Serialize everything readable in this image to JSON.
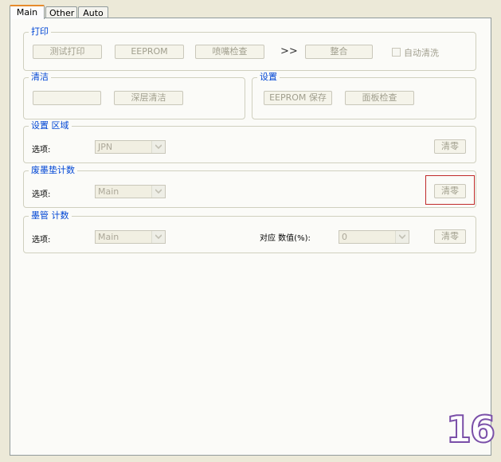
{
  "tabs": [
    {
      "label": "Main"
    },
    {
      "label": "Other"
    },
    {
      "label": "Auto"
    }
  ],
  "print_group": {
    "title": "打印",
    "btn_test_print": "测试打印",
    "btn_eeprom": "EEPROM",
    "btn_nozzle_check": "喷嘴检查",
    "arrow": ">>",
    "btn_align": "整合",
    "auto_clean_label": "自动清洗"
  },
  "clean_group": {
    "title": "清洁",
    "btn_blank": "",
    "btn_deep_clean": "深层清洁"
  },
  "settings_group": {
    "title": "设置",
    "btn_eeprom_save": "EEPROM 保存",
    "btn_panel_check": "面板检查"
  },
  "region_group": {
    "title": "设置 区域",
    "select_label": "选项:",
    "select_value": "JPN",
    "btn_reset": "清零"
  },
  "waste_group": {
    "title": "废墨垫计数",
    "select_label": "选项:",
    "select_value": "Main",
    "btn_reset": "清零"
  },
  "ink_group": {
    "title": "墨管 计数",
    "select_label": "选项:",
    "select_value": "Main",
    "value_label": "对应 数值(%):",
    "value_select": "0",
    "btn_reset": "清零"
  },
  "overlay_number": "16"
}
